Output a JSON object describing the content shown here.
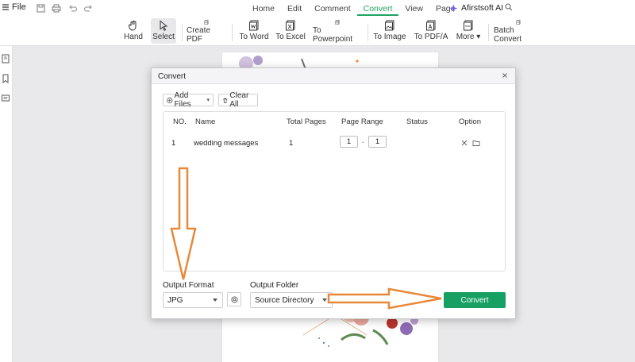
{
  "menubar": {
    "file_label": "File",
    "tabs": [
      {
        "label": "Home",
        "active": false
      },
      {
        "label": "Edit",
        "active": false
      },
      {
        "label": "Comment",
        "active": false
      },
      {
        "label": "Convert",
        "active": true
      },
      {
        "label": "View",
        "active": false
      },
      {
        "label": "Page",
        "active": false
      }
    ],
    "ai_label": "Afirstsoft AI"
  },
  "toolbar": {
    "hand": "Hand",
    "select": "Select",
    "create_pdf": "Create PDF",
    "to_word": "To Word",
    "to_excel": "To Excel",
    "to_powerpoint": "To Powerpoint",
    "to_image": "To Image",
    "to_pdfa": "To PDF/A",
    "more": "More",
    "batch_convert": "Batch Convert"
  },
  "dialog": {
    "title": "Convert",
    "add_files": "Add Files",
    "clear_all": "Clear All",
    "columns": {
      "no": "NO.",
      "name": "Name",
      "total_pages": "Total Pages",
      "page_range": "Page Range",
      "status": "Status",
      "option": "Option"
    },
    "rows": [
      {
        "no": "1",
        "name": "wedding messages",
        "total_pages": "1",
        "range_from": "1",
        "range_to": "1",
        "status": ""
      }
    ],
    "output_format_label": "Output Format",
    "output_format_value": "JPG",
    "output_folder_label": "Output Folder",
    "output_folder_value": "Source Directory",
    "convert_button": "Convert"
  },
  "colors": {
    "accent": "#1fa463",
    "convert_button": "#17a063",
    "annotation_arrow": "#e8893a"
  }
}
